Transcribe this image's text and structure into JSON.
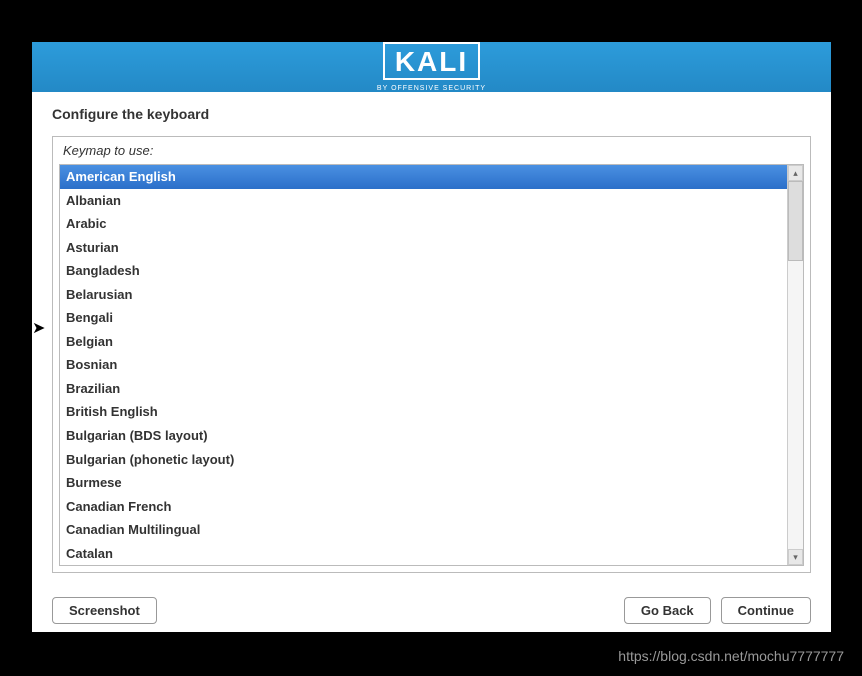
{
  "logo": {
    "text": "KALI",
    "subtitle": "BY OFFENSIVE SECURITY"
  },
  "page_title": "Configure the keyboard",
  "list_label": "Keymap to use:",
  "keymaps": [
    "American English",
    "Albanian",
    "Arabic",
    "Asturian",
    "Bangladesh",
    "Belarusian",
    "Bengali",
    "Belgian",
    "Bosnian",
    "Brazilian",
    "British English",
    "Bulgarian (BDS layout)",
    "Bulgarian (phonetic layout)",
    "Burmese",
    "Canadian French",
    "Canadian Multilingual",
    "Catalan"
  ],
  "selected_index": 0,
  "buttons": {
    "screenshot": "Screenshot",
    "go_back": "Go Back",
    "continue": "Continue"
  },
  "watermark": "https://blog.csdn.net/mochu7777777"
}
